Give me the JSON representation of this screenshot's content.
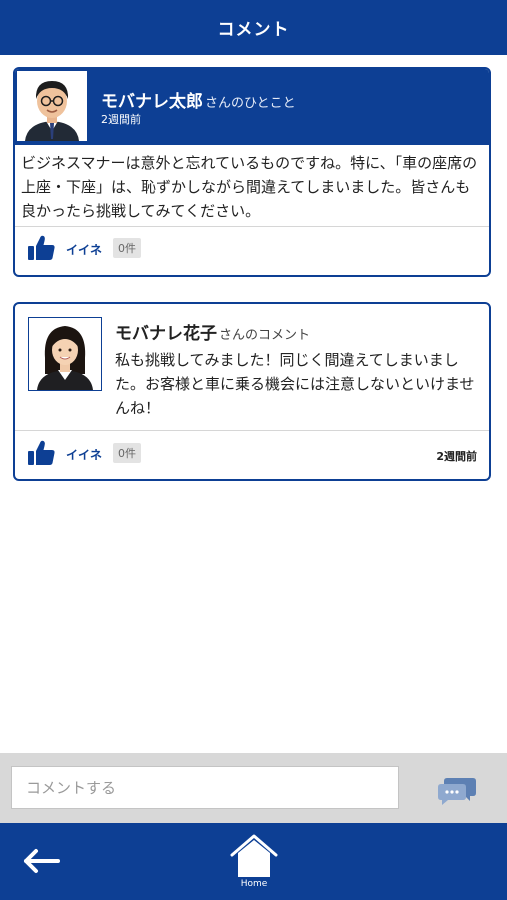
{
  "header": {
    "title": "コメント"
  },
  "post": {
    "author_name": "モバナレ太郎",
    "author_suffix": "さんのひとこと",
    "time": "2週間前",
    "body": "ビジネスマナーは意外と忘れているものですね。特に、「車の座席の上座・下座」は、恥ずかしながら間違えてしまいました。皆さんも良かったら挑戦してみてください。",
    "like_label": "イイネ",
    "like_count": "0件",
    "avatar_icon": "male-avatar"
  },
  "comments": [
    {
      "author_name": "モバナレ花子",
      "author_suffix": "さんのコメント",
      "body": "私も挑戦してみました！同じく間違えてしまいました。お客様と車に乗る機会には注意しないといけませんね！",
      "like_label": "イイネ",
      "like_count": "0件",
      "time": "2週間前",
      "avatar_icon": "female-avatar"
    }
  ],
  "comment_input": {
    "placeholder": "コメントする",
    "value": ""
  },
  "nav": {
    "home_label": "Home"
  },
  "icons": {
    "like": "thumbs-up-icon",
    "send": "chat-bubble-icon",
    "back": "arrow-left-icon",
    "home": "home-icon"
  },
  "colors": {
    "brand": "#0d3f94",
    "input_bar": "#d8d8d8",
    "badge": "#e3e3e3"
  }
}
